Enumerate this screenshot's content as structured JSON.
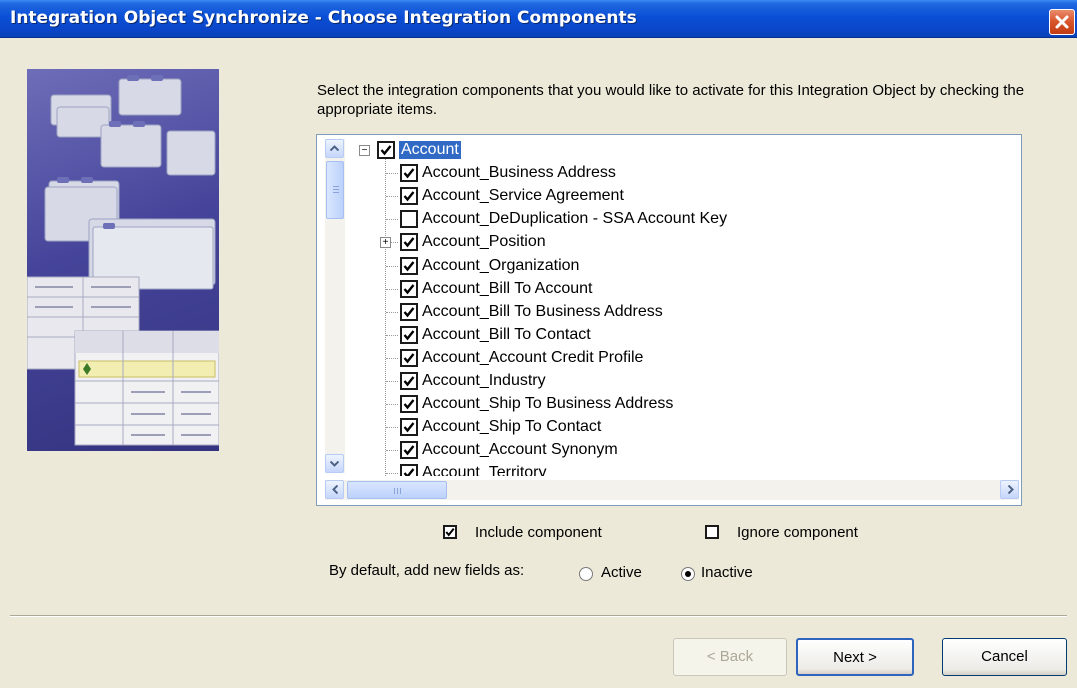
{
  "window": {
    "title": "Integration Object Synchronize - Choose Integration Components"
  },
  "instructions": "Select the integration components that you would like to activate for this Integration Object by checking the appropriate items.",
  "tree": {
    "root": {
      "label": "Account",
      "checked": true,
      "expanded": true
    },
    "items": [
      {
        "label": "Account_Business Address",
        "checked": true,
        "expandable": false
      },
      {
        "label": "Account_Service Agreement",
        "checked": true,
        "expandable": false
      },
      {
        "label": "Account_DeDuplication - SSA Account Key",
        "checked": false,
        "expandable": false
      },
      {
        "label": "Account_Position",
        "checked": true,
        "expandable": true
      },
      {
        "label": "Account_Organization",
        "checked": true,
        "expandable": false
      },
      {
        "label": "Account_Bill To Account",
        "checked": true,
        "expandable": false
      },
      {
        "label": "Account_Bill To Business Address",
        "checked": true,
        "expandable": false
      },
      {
        "label": "Account_Bill To Contact",
        "checked": true,
        "expandable": false
      },
      {
        "label": "Account_Account Credit Profile",
        "checked": true,
        "expandable": false
      },
      {
        "label": "Account_Industry",
        "checked": true,
        "expandable": false
      },
      {
        "label": "Account_Ship To Business Address",
        "checked": true,
        "expandable": false
      },
      {
        "label": "Account_Ship To Contact",
        "checked": true,
        "expandable": false
      },
      {
        "label": "Account_Account Synonym",
        "checked": true,
        "expandable": false
      },
      {
        "label": "Account_Territory",
        "checked": true,
        "expandable": false
      }
    ]
  },
  "legend": {
    "include": "Include component",
    "ignore": "Ignore component"
  },
  "defaults": {
    "label": "By default, add new fields as:",
    "options": [
      "Active",
      "Inactive"
    ],
    "selected": "Inactive"
  },
  "buttons": {
    "back": "< Back",
    "next": "Next >",
    "cancel": "Cancel"
  },
  "icons": {
    "close": "close-icon",
    "check": "checkmark-icon",
    "scroll_up": "chevron-up-icon",
    "scroll_down": "chevron-down-icon",
    "scroll_left": "chevron-left-icon",
    "scroll_right": "chevron-right-icon"
  },
  "colors": {
    "titlebar": "#0A4FD6",
    "selection": "#316AC5",
    "dialog_background": "#ECE9D8"
  }
}
